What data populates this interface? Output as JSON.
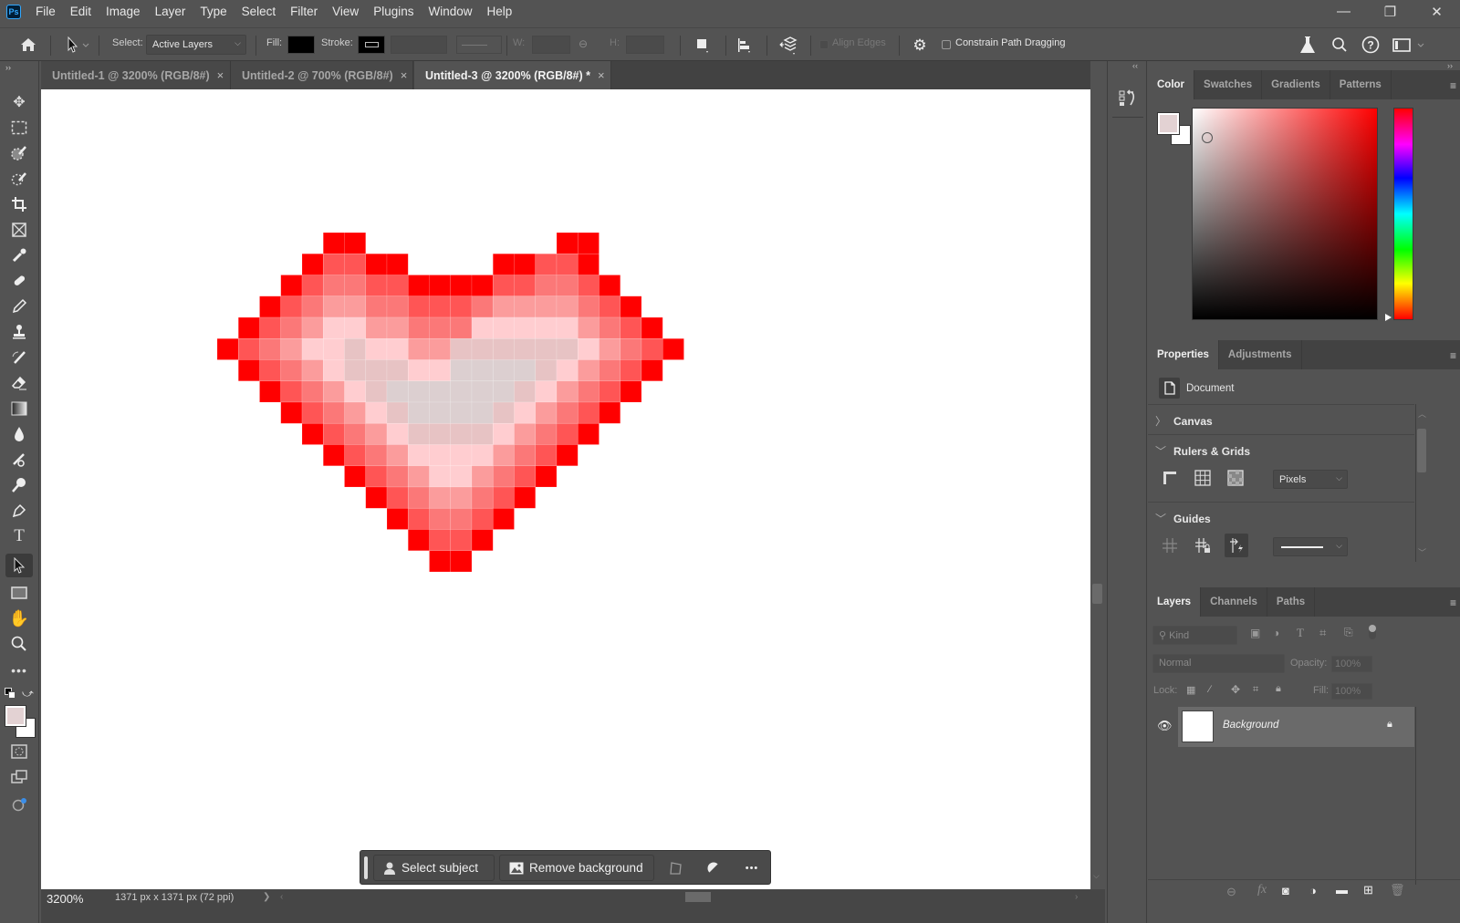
{
  "app": {
    "logo": "Ps",
    "window_controls": {
      "minimize": "—",
      "restore": "❐",
      "close": "✕"
    }
  },
  "menu": [
    "File",
    "Edit",
    "Image",
    "Layer",
    "Type",
    "Select",
    "Filter",
    "View",
    "Plugins",
    "Window",
    "Help"
  ],
  "options": {
    "select_label": "Select:",
    "select_value": "Active Layers",
    "fill_label": "Fill:",
    "stroke_label": "Stroke:",
    "w_label": "W:",
    "h_label": "H:",
    "align_edges_label": "Align Edges",
    "constrain_label": "Constrain Path Dragging",
    "fill_color": "#000000"
  },
  "tabs": [
    {
      "label": "Untitled-1 @ 3200% (RGB/8#)",
      "close": "×",
      "active": false
    },
    {
      "label": "Untitled-2 @ 700% (RGB/8#)",
      "close": "×",
      "active": false
    },
    {
      "label": "Untitled-3 @ 3200% (RGB/8#) *",
      "close": "×",
      "active": true
    }
  ],
  "tools": [
    "move-tool",
    "rectangular-marquee-tool",
    "object-selection-tool",
    "quick-selection-tool",
    "crop-tool",
    "frame-tool",
    "eyedropper-tool",
    "spot-healing-tool",
    "pencil-tool",
    "clone-stamp-tool",
    "history-brush-tool",
    "eraser-tool",
    "gradient-tool",
    "blur-tool",
    "smudge-tool",
    "dodge-tool",
    "pen-tool",
    "type-tool",
    "path-selection-tool",
    "rectangle-tool",
    "hand-tool",
    "zoom-tool",
    "edit-toolbar"
  ],
  "colors": {
    "foreground": "#e3d2d3",
    "background": "#ffffff"
  },
  "heart": {
    "palette": {
      "R": "#ff0000",
      "A": "#ff5555",
      "B": "#fb7878",
      "C": "#fb9c9c",
      "D": "#ffcdd0",
      "E": "#e7c3c4",
      "F": "#dccfd0"
    },
    "rows": [
      ".....RR.........RR....",
      "....RAARR....RRAAR....",
      "...RABBAARRRRAABBAR...",
      "..RABCCBBAAABCCCCBAR..",
      ".RABCDDCCBBBDDDDDCBAR.",
      "RABCDDEDDCCEEEEEEDCBAR",
      ".RABCDEEEDDFFFFEDCBAR.",
      "..RABCDEFFFFFFEDCBAR..",
      "...RABCDEFFFFEDCBAR...",
      "....RABCDEEEEDCBAR....",
      ".....RABCDDDDCBAR.....",
      "......RABCDDCBAR......",
      ".......RABCCBAR.......",
      "........RABBAR........",
      ".........RAAR.........",
      "..........RR.........."
    ]
  },
  "context_bar": {
    "select_subject": "Select subject",
    "remove_background": "Remove background",
    "more": "•••"
  },
  "status": {
    "zoom": "3200%",
    "doc_info": "1371 px x 1371 px (72 ppi)",
    "arrow": "❯"
  },
  "color_panel": {
    "tabs": [
      "Color",
      "Swatches",
      "Gradients",
      "Patterns"
    ],
    "active": "Color",
    "hue": "#ff0000"
  },
  "properties_panel": {
    "tabs": [
      "Properties",
      "Adjustments"
    ],
    "active": "Properties",
    "doc_label": "Document",
    "sections": {
      "canvas": "Canvas",
      "rulers": "Rulers & Grids",
      "guides": "Guides"
    },
    "units_value": "Pixels"
  },
  "layers_panel": {
    "tabs": [
      "Layers",
      "Channels",
      "Paths"
    ],
    "active": "Layers",
    "kind_placeholder": "Kind",
    "blend_mode": "Normal",
    "opacity_label": "Opacity:",
    "opacity_value": "100%",
    "lock_label": "Lock:",
    "fill_label": "Fill:",
    "fill_value": "100%",
    "layers": [
      {
        "name": "Background",
        "visible": true,
        "locked": true
      }
    ]
  }
}
